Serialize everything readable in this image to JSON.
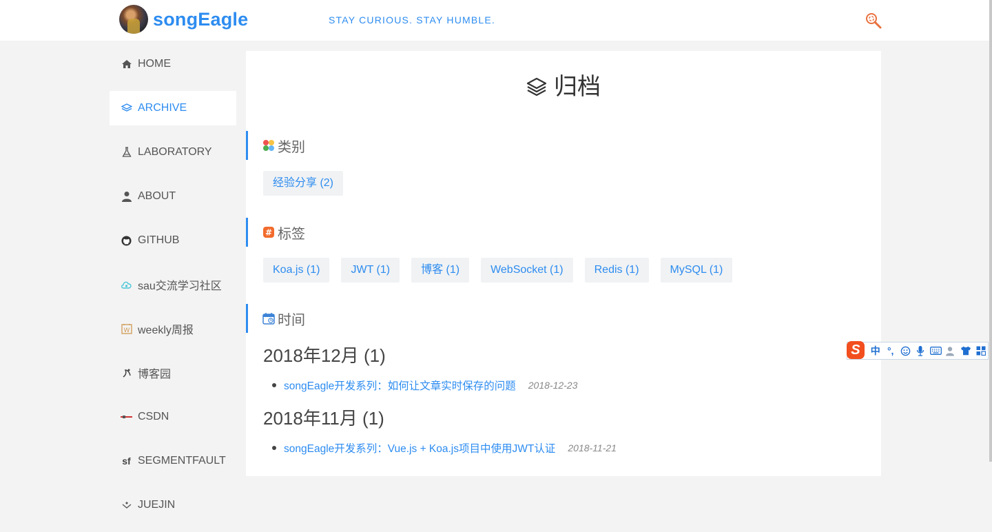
{
  "header": {
    "site_title": "songEagle",
    "motto": "STAY CURIOUS. STAY HUMBLE."
  },
  "sidebar": {
    "items": [
      {
        "label": "HOME",
        "icon": "home-icon",
        "active": false
      },
      {
        "label": "ARCHIVE",
        "icon": "layers-icon",
        "active": true
      },
      {
        "label": "LABORATORY",
        "icon": "flask-icon",
        "active": false
      },
      {
        "label": "ABOUT",
        "icon": "user-icon",
        "active": false
      },
      {
        "label": "GITHUB",
        "icon": "github-icon",
        "active": false
      },
      {
        "label": "sau交流学习社区",
        "icon": "cloud-icon",
        "active": false
      },
      {
        "label": "weekly周报",
        "icon": "weekly-icon",
        "active": false
      },
      {
        "label": "博客园",
        "icon": "cnblogs-icon",
        "active": false
      },
      {
        "label": "CSDN",
        "icon": "csdn-icon",
        "active": false
      },
      {
        "label": "SEGMENTFAULT",
        "icon": "sf-icon",
        "active": false
      },
      {
        "label": "JUEJIN",
        "icon": "juejin-icon",
        "active": false
      }
    ]
  },
  "main": {
    "title": "归档",
    "categories": {
      "heading": "类别",
      "items": [
        "经验分享 (2)"
      ]
    },
    "tags": {
      "heading": "标签",
      "items": [
        "Koa.js (1)",
        "JWT (1)",
        "博客 (1)",
        "WebSocket (1)",
        "Redis (1)",
        "MySQL (1)"
      ]
    },
    "timeline": {
      "heading": "时间",
      "months": [
        {
          "label": "2018年12月 (1)",
          "posts": [
            {
              "title": "songEagle开发系列：如何让文章实时保存的问题",
              "date": "2018-12-23"
            }
          ]
        },
        {
          "label": "2018年11月 (1)",
          "posts": [
            {
              "title": "songEagle开发系列：Vue.js + Koa.js项目中使用JWT认证",
              "date": "2018-11-21"
            }
          ]
        }
      ]
    }
  },
  "ime_toolbar": {
    "logo": "S",
    "mode": "中",
    "punct": "°,",
    "buttons": [
      "emoji-icon",
      "mic-icon",
      "keyboard-icon",
      "user-icon",
      "skin-icon",
      "toolbox-icon"
    ]
  },
  "colors": {
    "accent": "#2d8cf0",
    "background": "#f3f3f3",
    "search_icon": "#e9703e",
    "ime_logo": "#f24e1e"
  }
}
